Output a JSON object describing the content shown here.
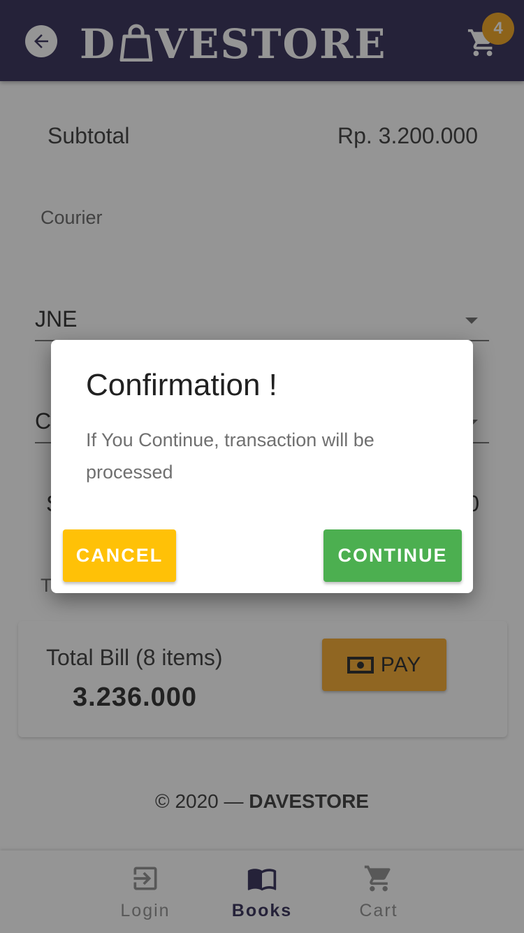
{
  "app_bar": {
    "logo_text_left": "D",
    "logo_text_right": "VESTORE",
    "cart_count": "4"
  },
  "summary": {
    "subtotal_label": "Subtotal",
    "subtotal_value": "Rp. 3.200.000",
    "courier_label": "Courier",
    "courier_value": "JNE",
    "service_value": "C",
    "shipping_label": "S",
    "shipping_value": "0",
    "total_section_label": "T"
  },
  "total": {
    "title": "Total Bill (8 items)",
    "amount": "3.236.000",
    "pay_label": "PAY"
  },
  "footer": {
    "copyright": "© 2020 — ",
    "brand": "DAVESTORE"
  },
  "bottom_nav": {
    "items": [
      {
        "label": "Login",
        "icon": "login-icon"
      },
      {
        "label": "Books",
        "icon": "book-open-icon",
        "active": true
      },
      {
        "label": "Cart",
        "icon": "cart-icon"
      }
    ]
  },
  "dialog": {
    "title": "Confirmation !",
    "message": "If You Continue, transaction will be processed",
    "cancel_label": "CANCEL",
    "continue_label": "CONTINUE"
  },
  "colors": {
    "app_bar": "#2a2350",
    "badge": "#ef9f15",
    "cancel": "#ffc107",
    "continue": "#4caf50",
    "pay": "#f5a623"
  }
}
